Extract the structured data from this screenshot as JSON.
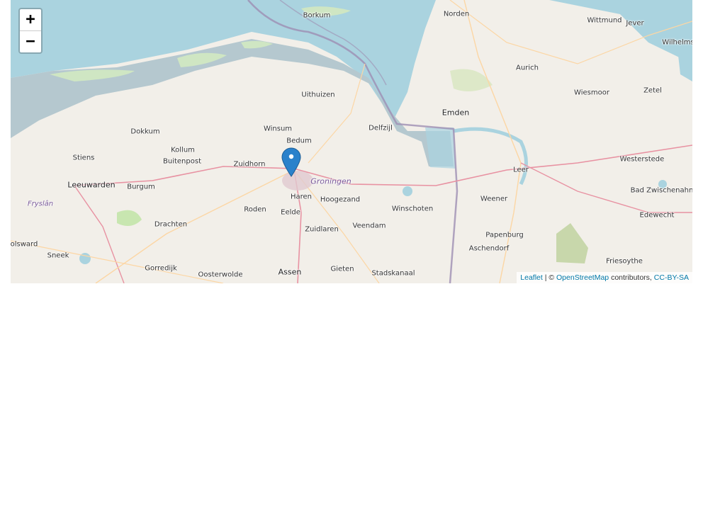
{
  "zoom_controls": {
    "zoom_in": "+",
    "zoom_out": "−"
  },
  "attribution": {
    "leaflet": "Leaflet",
    "separator": " | © ",
    "osm": "OpenStreetMap",
    "contributors": " contributors, ",
    "license": "CC-BY-SA"
  },
  "places": {
    "borkum": "Borkum",
    "norden": "Norden",
    "wittmund": "Wittmund",
    "jever": "Jever",
    "wilhelms": "Wilhelms",
    "aurich": "Aurich",
    "uithuizen": "Uithuizen",
    "wiesmoor": "Wiesmoor",
    "zetel": "Zetel",
    "emden": "Emden",
    "dokkum": "Dokkum",
    "winsum": "Winsum",
    "delfzijl": "Delfzijl",
    "bedum": "Bedum",
    "kollum": "Kollum",
    "stiens": "Stiens",
    "buitenpost": "Buitenpost",
    "zuidhorn": "Zuidhorn",
    "westerstede": "Westerstede",
    "leer": "Leer",
    "groningen": "Groningen",
    "leeuwarden": "Leeuwarden",
    "burgum": "Burgum",
    "bad_zwischenahn": "Bad Zwischenahn",
    "weener": "Weener",
    "hoogezand": "Hoogezand",
    "haren": "Haren",
    "fryslan": "Fryslân",
    "roden": "Roden",
    "eelde": "Eelde",
    "winschoten": "Winschoten",
    "edewecht": "Edewecht",
    "drachten": "Drachten",
    "veendam": "Veendam",
    "zuidlaren": "Zuidlaren",
    "papenburg": "Papenburg",
    "bolsward": "olsward",
    "aschendorf": "Aschendorf",
    "sneek": "Sneek",
    "friesoythe": "Friesoythe",
    "gorredijk": "Gorredijk",
    "oosterwolde": "Oosterwolde",
    "assen": "Assen",
    "gieten": "Gieten",
    "stadskanaal": "Stadskanaal"
  },
  "marker": {
    "icon": "map-pin-icon",
    "color": "#2a81cb"
  },
  "colors": {
    "water": "#aad3df",
    "land": "#f2efe9",
    "wadden": "#b5c8cf"
  }
}
